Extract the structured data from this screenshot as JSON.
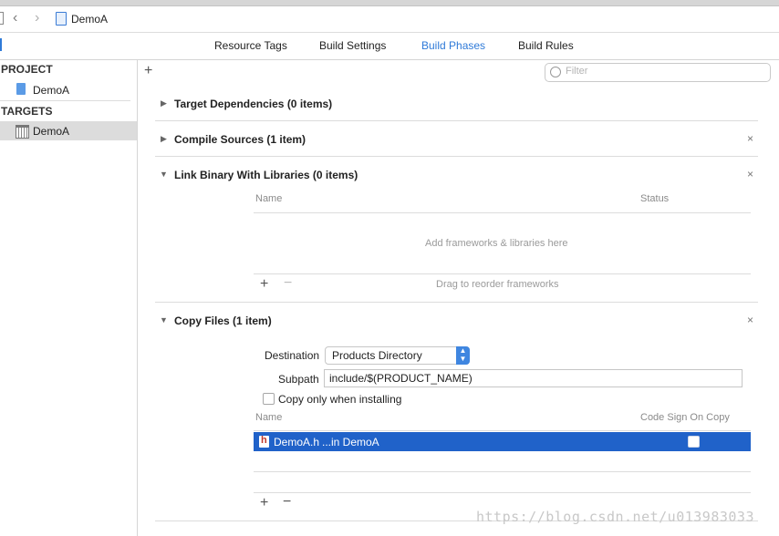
{
  "navbar": {
    "title": "DemoA"
  },
  "tabs": [
    {
      "label": "Resource Tags"
    },
    {
      "label": "Build Settings"
    },
    {
      "label": "Build Phases"
    },
    {
      "label": "Build Rules"
    }
  ],
  "sidebar": {
    "project_header": "PROJECT",
    "project_item": "DemoA",
    "targets_header": "TARGETS",
    "target_item": "DemoA"
  },
  "filter": {
    "placeholder": "Filter"
  },
  "phases": {
    "target_dependencies": "Target Dependencies (0 items)",
    "compile_sources": "Compile Sources (1 item)",
    "link_binary": "Link Binary With Libraries (0 items)",
    "copy_files": "Copy Files (1 item)"
  },
  "link": {
    "col_name": "Name",
    "col_status": "Status",
    "empty": "Add frameworks & libraries here",
    "drag_hint": "Drag to reorder frameworks"
  },
  "copy": {
    "destination_label": "Destination",
    "destination_value": "Products Directory",
    "subpath_label": "Subpath",
    "subpath_value": "include/$(PRODUCT_NAME)",
    "only_installing": "Copy only when installing",
    "col_name": "Name",
    "col_codesign": "Code Sign On Copy",
    "file_name": "DemoA.h",
    "file_location": "...in DemoA"
  },
  "watermark": "https://blog.csdn.net/u013983033",
  "colors": {
    "accent": "#2f7ad8",
    "selection": "#2062c9"
  }
}
